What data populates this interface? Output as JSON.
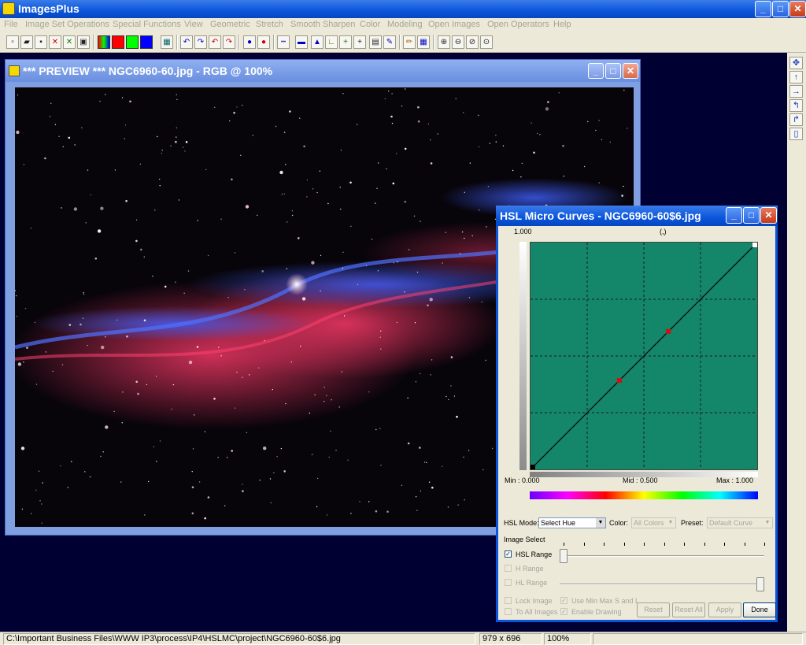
{
  "app": {
    "title": "ImagesPlus",
    "min": "_",
    "max": "□",
    "close": "✕"
  },
  "menu": [
    "File",
    "Image Set Operations",
    "Special Functions",
    "View",
    "Geometric",
    "Stretch",
    "Smooth Sharpen",
    "Color",
    "Modeling",
    "Open Images",
    "Open Operators",
    "Help"
  ],
  "toolbar": {
    "icons": [
      "new-icon",
      "open-icon",
      "save-icon",
      "delete-icon",
      "close-all-icon",
      "copy-icon",
      "rgb-icon",
      "red-icon",
      "green-icon",
      "blue-icon",
      "grid-icon",
      "undo-icon",
      "redo-icon",
      "undo-all-icon",
      "redo-all-icon",
      "circle-icon",
      "ellipse-icon",
      "line-icon",
      "triangle-icon",
      "measure-icon",
      "crosshair-icon",
      "cross-icon",
      "frame-icon",
      "stack-icon",
      "pencil-icon",
      "mask-icon",
      "zoom-in-icon",
      "zoom-out-icon",
      "zoom-fit-icon",
      "zoom-100-icon"
    ],
    "colors": {
      "red": "#ff0000",
      "green": "#00ff00",
      "blue": "#0000ff"
    }
  },
  "right_toolbar": [
    "move-icon",
    "up-icon",
    "right-icon",
    "rotate-left-icon",
    "rotate-right-icon",
    "page-icon"
  ],
  "preview": {
    "title": "*** PREVIEW *** NGC6960-60.jpg - RGB @  100%"
  },
  "dialog": {
    "title": "HSL Micro Curves - NGC6960-60$6.jpg",
    "top_value": "1.000",
    "coord": "(,)",
    "min_label": "Min :  0.000",
    "mid_label": "Mid :  0.500",
    "max_label": "Max :  1.000",
    "hsl_mode_label": "HSL Mode:",
    "hsl_mode_value": "Select Hue",
    "color_label": "Color:",
    "color_value": "All Colors",
    "preset_label": "Preset:",
    "preset_value": "Default Curve",
    "image_select": "Image Select",
    "hsl_range": "HSL Range",
    "h_range": "H Range",
    "hl_range": "HL Range",
    "lock_image": "Lock Image",
    "to_all_images": "To All Images",
    "use_min_max": "Use Min Max S and L",
    "enable_drawing": "Enable Drawing",
    "reset": "Reset",
    "reset_all": "Reset All",
    "apply": "Apply",
    "done": "Done",
    "curve_points": [
      [
        0,
        0
      ],
      [
        0.392,
        0.392
      ],
      [
        0.608,
        0.608
      ],
      [
        1,
        1
      ]
    ],
    "plot_color": "#14866a"
  },
  "status": {
    "path": "C:\\Important Business Files\\WWW IP3\\process\\IP4\\HSLMC\\project\\NGC6960-60$6.jpg",
    "size": "979 x 696",
    "zoom": "100%"
  }
}
